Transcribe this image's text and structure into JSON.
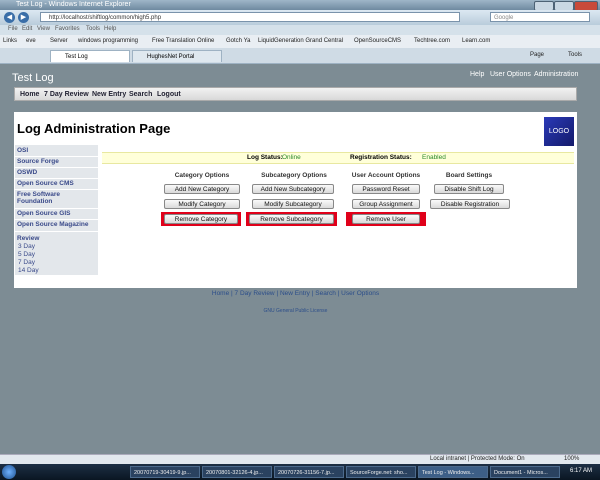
{
  "browser": {
    "window_title": "Test Log - Windows Internet Explorer",
    "address": "http://localhost/shiftlog/common/high5.php",
    "search_placeholder": "Google",
    "menu": [
      "File",
      "Edit",
      "View",
      "Favorites",
      "Tools",
      "Help"
    ],
    "links": [
      "Links",
      "eve",
      "Server",
      "windows programming",
      "Free Translation Online",
      "Gotch Ya",
      "LiquidGeneration Grand Central",
      "OpenSourceCMS",
      "Techtree.com",
      "Learn.com"
    ],
    "tabs": [
      "Test Log",
      "HughesNet Portal"
    ],
    "commands": [
      "Page",
      "Tools"
    ],
    "status_zone": "Local intranet | Protected Mode: On",
    "zoom": "100%"
  },
  "app": {
    "logo_text": "Test Log",
    "header_links": [
      "Help",
      "User Options",
      "Administration"
    ],
    "nav": [
      "Home",
      "7 Day Review",
      "New Entry",
      "Search",
      "Logout"
    ],
    "page_title": "Log Administration Page",
    "logo_box": "LOGO"
  },
  "sidebar": {
    "items": [
      "OSI",
      "Source Forge",
      "OSWD",
      "Open Source CMS",
      "Free Software Foundation",
      "Open Source GIS",
      "Open Source Magazine"
    ],
    "review_label": "Review",
    "review_links": [
      "3 Day",
      "5 Day",
      "7 Day",
      "14 Day"
    ]
  },
  "status": {
    "log_status_label": "Log Status:",
    "log_status_value": "Online",
    "registration_label": "Registration Status:",
    "registration_value": "Enabled"
  },
  "sections": [
    {
      "title": "Category Options",
      "buttons": [
        "Add New Category",
        "Modify Category",
        "Remove Category"
      ]
    },
    {
      "title": "Subcategory Options",
      "buttons": [
        "Add New Subcategory",
        "Modify Subcategory",
        "Remove Subcategory"
      ]
    },
    {
      "title": "User Account Options",
      "buttons": [
        "Password Reset",
        "Group Assignment",
        "Remove User"
      ]
    },
    {
      "title": "Board Settings",
      "buttons": [
        "Disable Shift Log",
        "Disable Registration"
      ]
    }
  ],
  "footer": {
    "links": [
      "Home",
      "7 Day Review",
      "New Entry",
      "Search",
      "User Options"
    ],
    "license": "GNU General Public License"
  },
  "taskbar": {
    "items": [
      "20070719-30419-9.jp...",
      "20070801-32126-4.jp...",
      "20070726-31156-7.jp...",
      "SourceForge.net: sho...",
      "Test Log - Windows...",
      "Document1 - Micros..."
    ],
    "clock": "6:17 AM"
  },
  "colors": {
    "accent_red": "#e0001a",
    "page_bg": "#7d8c94",
    "status_online": "#2a8a2a"
  }
}
